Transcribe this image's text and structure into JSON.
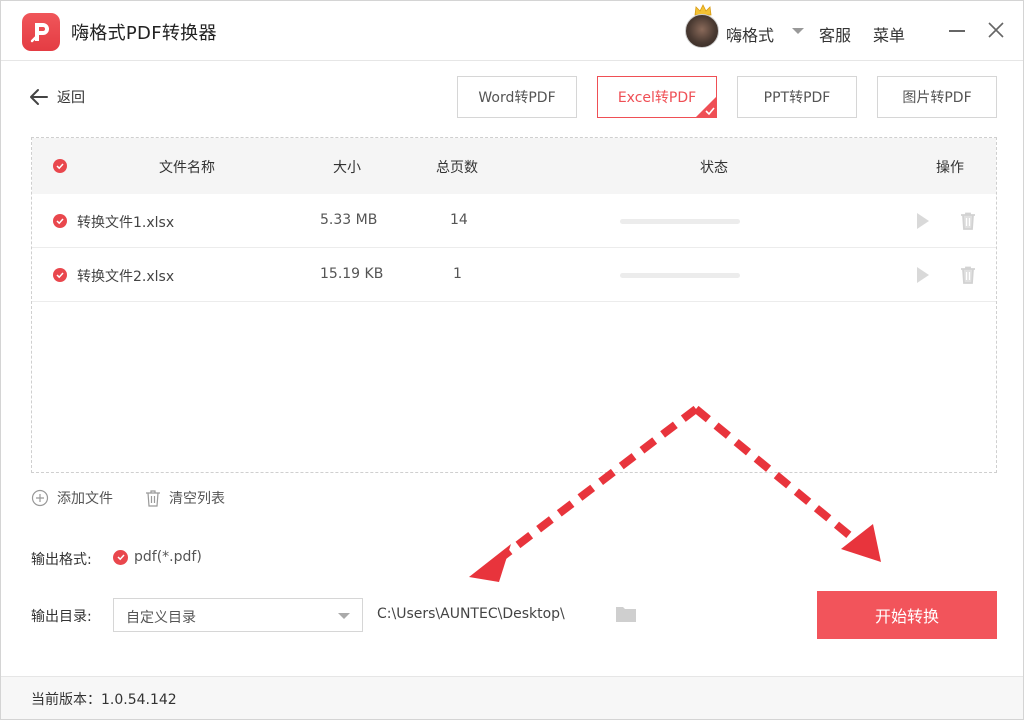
{
  "app": {
    "title": "嗨格式PDF转换器",
    "accent": "#ef4f55"
  },
  "header": {
    "username": "嗨格式",
    "service_label": "客服",
    "menu_label": "菜单"
  },
  "toolbar": {
    "back_label": "返回",
    "tabs": [
      {
        "label": "Word转PDF",
        "active": false
      },
      {
        "label": "Excel转PDF",
        "active": true
      },
      {
        "label": "PPT转PDF",
        "active": false
      },
      {
        "label": "图片转PDF",
        "active": false
      }
    ]
  },
  "table": {
    "headers": {
      "name": "文件名称",
      "size": "大小",
      "pages": "总页数",
      "status": "状态",
      "actions": "操作"
    },
    "rows": [
      {
        "name": "转换文件1.xlsx",
        "size": "5.33 MB",
        "pages": "14",
        "progress": 0
      },
      {
        "name": "转换文件2.xlsx",
        "size": "15.19 KB",
        "pages": "1",
        "progress": 0
      }
    ]
  },
  "actions": {
    "add_file_label": "添加文件",
    "clear_list_label": "清空列表"
  },
  "output": {
    "format_label": "输出格式:",
    "format_value": "pdf(*.pdf)",
    "dir_label": "输出目录:",
    "dir_select_value": "自定义目录",
    "dir_path": "C:\\Users\\AUNTEC\\Desktop\\",
    "start_label": "开始转换"
  },
  "footer": {
    "version_label": "当前版本：1.0.54.142"
  },
  "icons": {
    "logo": "pdf-p-logo-icon",
    "back": "arrow-left-icon",
    "play": "play-icon",
    "delete": "trash-icon",
    "add": "plus-circle-icon",
    "clear": "trash-icon",
    "folder": "folder-icon",
    "check": "check-circle-icon"
  }
}
